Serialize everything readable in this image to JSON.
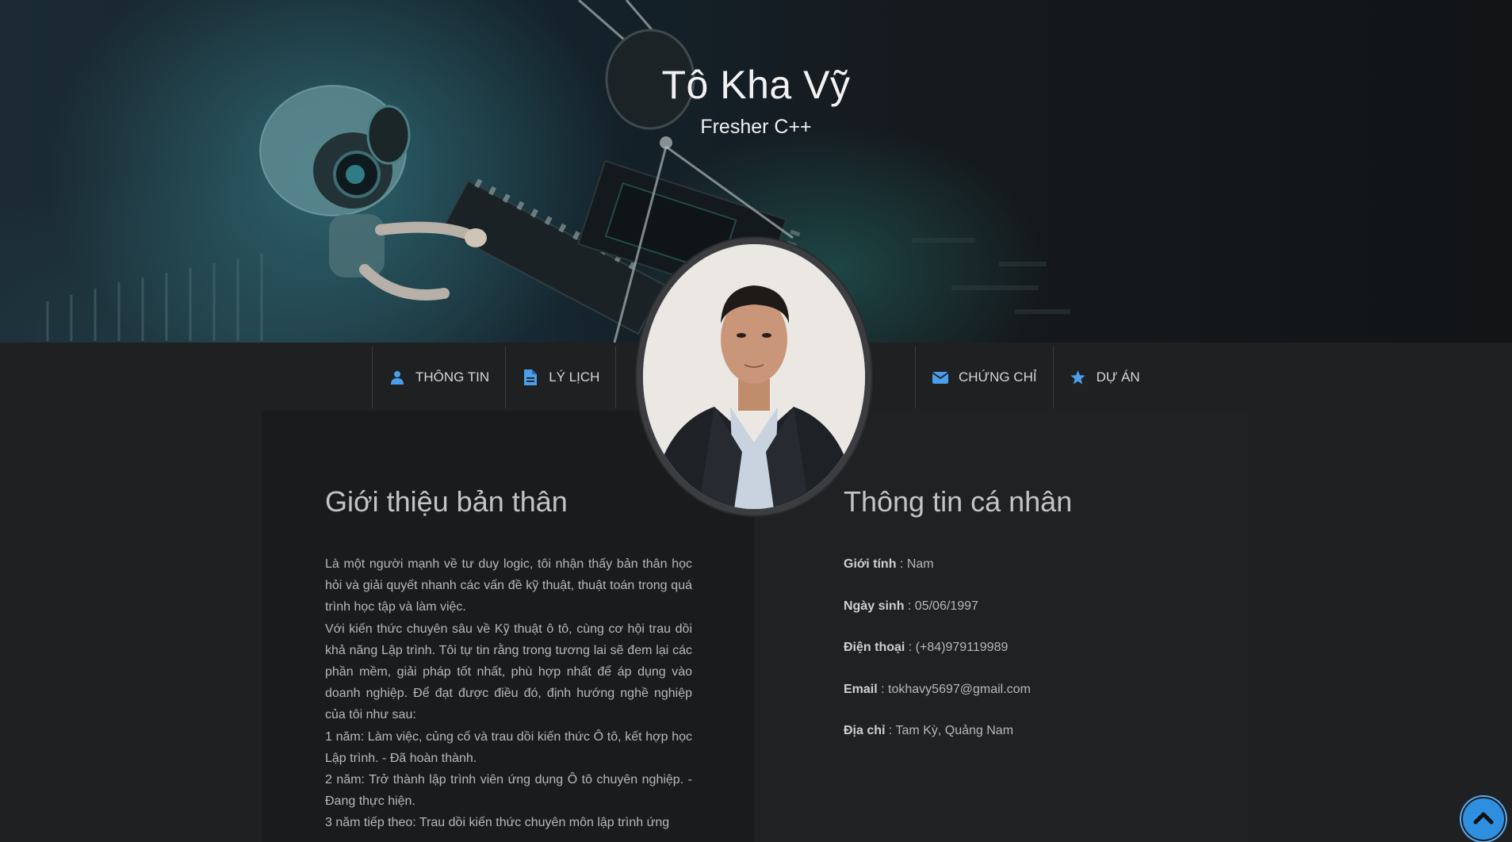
{
  "header": {
    "name": "Tô Kha Vỹ",
    "role": "Fresher C++"
  },
  "nav": {
    "left": [
      {
        "label": "THÔNG TIN",
        "icon": "user-icon"
      },
      {
        "label": "LÝ LỊCH",
        "icon": "document-icon"
      }
    ],
    "right": [
      {
        "label": "CHỨNG CHỈ",
        "icon": "envelope-icon"
      },
      {
        "label": "DỰ ÁN",
        "icon": "star-icon"
      }
    ]
  },
  "about": {
    "title": "Giới thiệu bản thân",
    "paragraphs": [
      "Là một người mạnh về tư duy logic, tôi nhận thấy bản thân học hỏi và giải quyết nhanh các vấn đề kỹ thuật, thuật toán trong quá trình học tập và làm việc.",
      "Với kiến thức chuyên sâu về Kỹ thuật ô tô, cùng cơ hội trau dồi khả năng Lập trình. Tôi tự tin rằng trong tương lai sẽ đem lại các phần mềm, giải pháp tốt nhất, phù hợp nhất để áp dụng vào doanh nghiệp. Để đạt được điều đó, định hướng nghề nghiệp của tôi như sau:",
      "1 năm: Làm việc, củng cố và trau dồi kiến thức Ô tô, kết hợp học Lập trình. - Đã hoàn thành.",
      "2 năm: Trở thành lập trình viên ứng dụng Ô tô chuyên nghiệp. - Đang thực hiện.",
      "3 năm tiếp theo: Trau dồi kiến thức chuyên môn lập trình ứng"
    ]
  },
  "personal": {
    "title": "Thông tin cá nhân",
    "rows": [
      {
        "label": "Giới tính",
        "value": " : Nam"
      },
      {
        "label": "Ngày sinh",
        "value": " : 05/06/1997"
      },
      {
        "label": "Điện thoại",
        "value": " : (+84)979119989"
      },
      {
        "label": "Email",
        "value": " : tokhavy5697@gmail.com"
      },
      {
        "label": "Địa chỉ",
        "value": " : Tam Kỳ, Quảng Nam"
      }
    ]
  },
  "colors": {
    "accent": "#4a9eea",
    "scroll_button": "#2e8fe0",
    "background": "#1f2022"
  },
  "icons": {
    "scroll_top": "chevron-up-icon"
  }
}
